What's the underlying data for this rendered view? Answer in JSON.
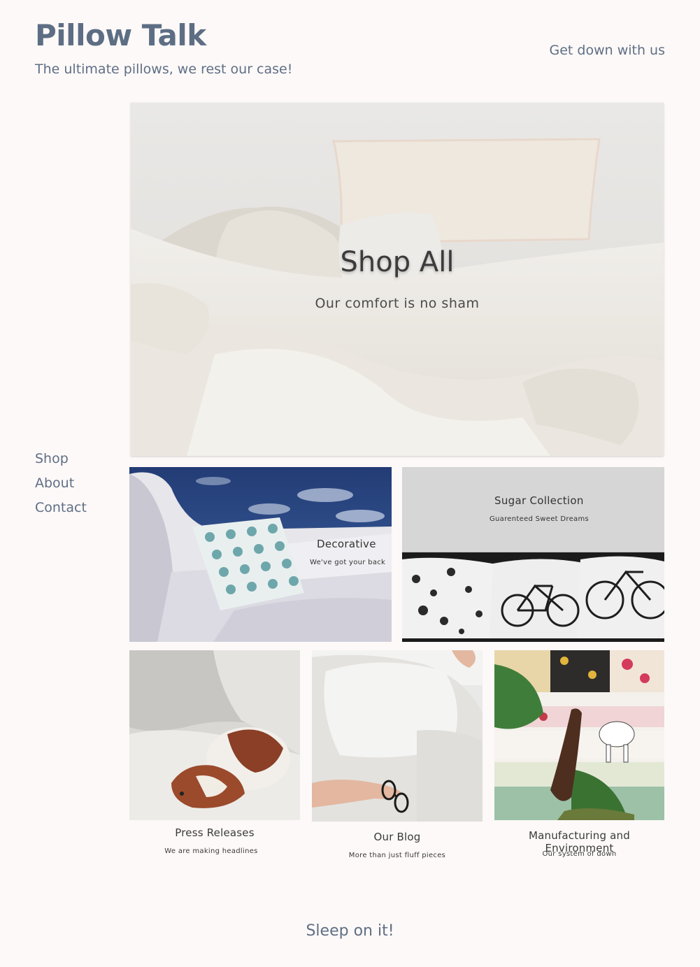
{
  "header": {
    "title": "Pillow Talk",
    "tagline": "The ultimate pillows, we rest our case!",
    "top_link": "Get down with us"
  },
  "nav": {
    "items": [
      {
        "label": "Shop"
      },
      {
        "label": "About"
      },
      {
        "label": "Contact"
      }
    ]
  },
  "hero": {
    "heading": "Shop All",
    "subheading": "Our comfort is no sham"
  },
  "collections": [
    {
      "title": "Decorative",
      "subtitle": "We've got your back"
    },
    {
      "title": "Sugar Collection",
      "subtitle": "Guarenteed Sweet Dreams"
    }
  ],
  "cards": [
    {
      "title": "Press Releases",
      "subtitle": "We are making headlines"
    },
    {
      "title": "Our Blog",
      "subtitle": "More than just fluff pieces"
    },
    {
      "title": "Manufacturing and Environment",
      "subtitle": "Our system of down"
    }
  ],
  "footer": {
    "text": "Sleep on it!"
  },
  "colors": {
    "background": "#fdf9f8",
    "text_primary": "#5f6f85"
  }
}
